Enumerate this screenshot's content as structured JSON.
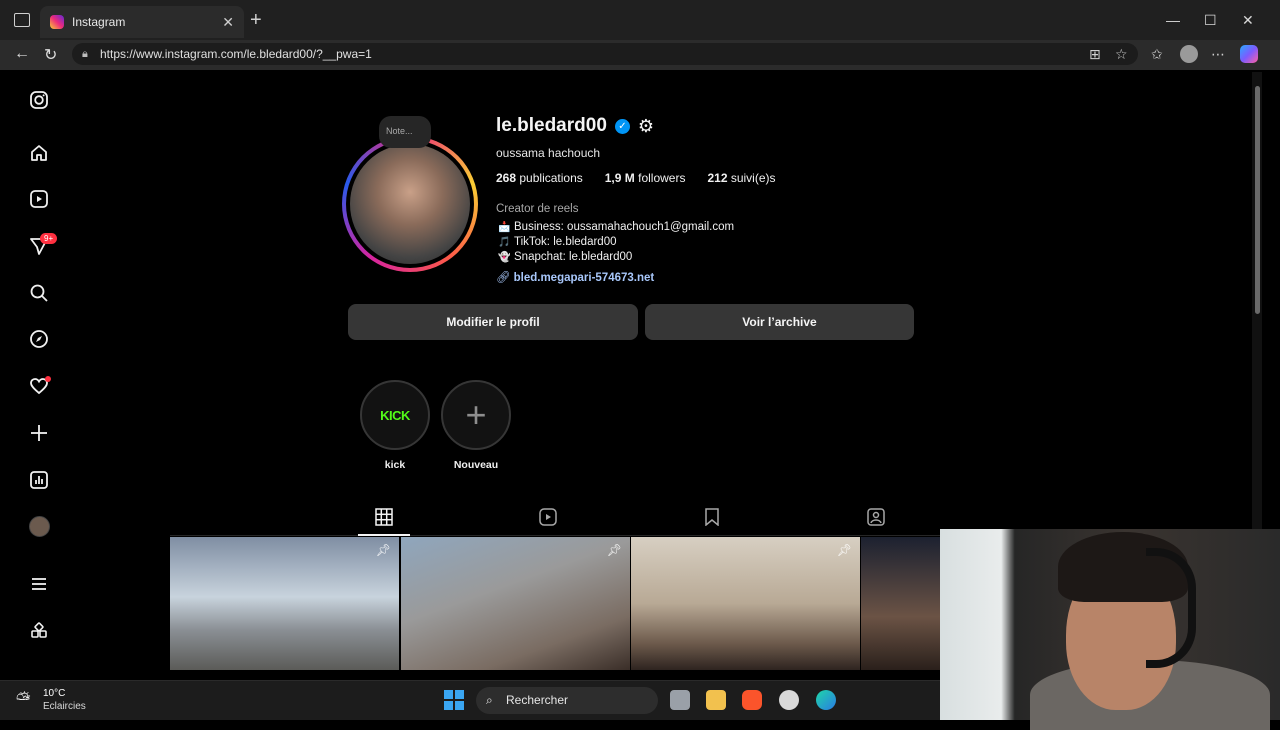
{
  "browser": {
    "tab_title": "Instagram",
    "url": "https://www.instagram.com/le.bledard00/?__pwa=1"
  },
  "sidebar": {
    "notifications_badge": "9+"
  },
  "profile": {
    "note_placeholder": "Note...",
    "username": "le.bledard00",
    "full_name": "oussama hachouch",
    "stats": {
      "publications_count": "268",
      "publications_label": "publications",
      "followers_count": "1,9 M",
      "followers_label": "followers",
      "following_count": "212",
      "following_label": "suivi(e)s"
    },
    "category": "Creator de reels",
    "bio_lines": [
      {
        "emoji": "📩",
        "text": "Business: oussamahachouch1@gmail.com"
      },
      {
        "emoji": "🎵",
        "text": "TikTok: le.bledard00"
      },
      {
        "emoji": "👻",
        "text": "Snapchat: le.bledard00"
      }
    ],
    "link": "bled.megapari-574673.net",
    "edit_profile_button": "Modifier le profil",
    "view_archive_button": "Voir l’archive"
  },
  "highlights": [
    {
      "label": "kick",
      "cover_text": "KICK"
    },
    {
      "label": "Nouveau"
    }
  ],
  "taskbar": {
    "temperature": "10°C",
    "weather_condition": "Eclaircies",
    "search_placeholder": "Rechercher"
  },
  "colors": {
    "background": "#000000",
    "button": "#363636",
    "verified": "#0095f6",
    "link": "#a8c7fa",
    "badge": "#ff3040",
    "kick_green": "#53fc18"
  }
}
